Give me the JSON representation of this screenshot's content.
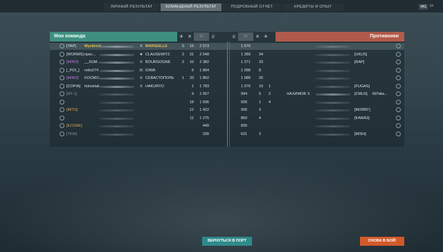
{
  "tabs": [
    {
      "label": "ЛИЧНЫЙ РЕЗУЛЬТАТ",
      "active": false
    },
    {
      "label": "КОМАНДНЫЙ РЕЗУЛЬТАТ",
      "active": true
    },
    {
      "label": "ПОДРОБНЫЙ ОТЧЁТ",
      "active": false
    },
    {
      "label": "КРЕДИТЫ И ОПЫТ",
      "active": false
    }
  ],
  "version": {
    "badge": "WG",
    "text": "34"
  },
  "my_team": {
    "title": "Моя команда",
    "rows": [
      {
        "clan": "[YAP]",
        "name": "Mystirich",
        "tier": "X",
        "ship": "MARSEILLE",
        "kills": "5",
        "plane": "15",
        "xp": "2 573",
        "me": true
      },
      {
        "clan": "[WORMS]",
        "name": "npec...",
        "tier": "★",
        "ship": "CLAUSEWITZ",
        "kills": "2",
        "plane": "31",
        "xp": "2 548",
        "me": false
      },
      {
        "clan": "[MINO]",
        "name": "__XUM...",
        "tier": "X",
        "ship": "BOURGOGNE",
        "kills": "2",
        "plane": "10",
        "xp": "2 382",
        "me": false
      },
      {
        "clan": "[_POI_]",
        "name": "retto274",
        "tier": "IX",
        "ship": "IOWA",
        "kills": "",
        "plane": "6",
        "xp": "1 894",
        "me": false
      },
      {
        "clan": "[MINO]",
        "name": "KOCMO...",
        "tier": "X",
        "ship": "СЕВАСТОПОЛЬ",
        "kills": "1",
        "plane": "33",
        "xp": "1 862",
        "me": false
      },
      {
        "clan": "[COPIA]",
        "name": "holostiak",
        "tier": "X",
        "ship": "HAKURYŪ",
        "kills": "",
        "plane": "1",
        "xp": "1 783",
        "me": false
      },
      {
        "clan": "[RF-1]",
        "name": "",
        "tier": "",
        "ship": "",
        "kills": "",
        "plane": "9",
        "xp": "1 557",
        "me": false
      },
      {
        "clan": "",
        "name": "",
        "tier": "",
        "ship": "",
        "kills": "",
        "plane": "18",
        "xp": "1 506",
        "me": false
      },
      {
        "clan": "[MITS]",
        "name": "",
        "tier": "",
        "ship": "",
        "kills": "",
        "plane": "12",
        "xp": "1 422",
        "me": false
      },
      {
        "clan": "",
        "name": "",
        "tier": "",
        "ship": "",
        "kills": "",
        "plane": "11",
        "xp": "1 275",
        "me": false
      },
      {
        "clan": "[ECORE]",
        "name": "",
        "tier": "",
        "ship": "",
        "kills": "",
        "plane": "",
        "xp": "449",
        "me": false
      },
      {
        "clan": "[TKW]",
        "name": "",
        "tier": "",
        "ship": "",
        "kills": "",
        "plane": "",
        "xp": "339",
        "me": false
      }
    ]
  },
  "enemy_team": {
    "title": "Противники",
    "rows": [
      {
        "xp": "1 676",
        "plane": "",
        "kills": "",
        "ship": "",
        "tier": "",
        "clan": "",
        "name": ""
      },
      {
        "xp": "1 289",
        "plane": "34",
        "kills": "",
        "ship": "",
        "tier": "",
        "clan": "[UKUS]",
        "name": ""
      },
      {
        "xp": "1 271",
        "plane": "33",
        "kills": "",
        "ship": "",
        "tier": "",
        "clan": "[RAP]",
        "name": ""
      },
      {
        "xp": "1 098",
        "plane": "8",
        "kills": "",
        "ship": "",
        "tier": "",
        "clan": "",
        "name": ""
      },
      {
        "xp": "1 088",
        "plane": "26",
        "kills": "",
        "ship": "",
        "tier": "",
        "clan": "",
        "name": ""
      },
      {
        "xp": "1 076",
        "plane": "10",
        "kills": "1",
        "ship": "",
        "tier": "",
        "clan": "[FUGAS]",
        "name": ""
      },
      {
        "xp": "994",
        "plane": "5",
        "kills": "2",
        "ship": "НАХИМОВ",
        "tier": "X",
        "clan": "[CMLN]",
        "name": "69Taks..."
      },
      {
        "xp": "936",
        "plane": "1",
        "kills": "4",
        "ship": "",
        "tier": "",
        "clan": "",
        "name": ""
      },
      {
        "xp": "936",
        "plane": "3",
        "kills": "",
        "ship": "",
        "tier": "",
        "clan": "[MORBT]",
        "name": ""
      },
      {
        "xp": "850",
        "plane": "4",
        "kills": "",
        "ship": "",
        "tier": "",
        "clan": "[KAMA3]",
        "name": ""
      },
      {
        "xp": "835",
        "plane": "",
        "kills": "",
        "ship": "",
        "tier": "",
        "clan": "",
        "name": ""
      },
      {
        "xp": "631",
        "plane": "2",
        "kills": "",
        "ship": "",
        "tier": "",
        "clan": "[MISH]",
        "name": ""
      }
    ]
  },
  "buttons": {
    "port": "ВЕРНУТЬСЯ В ПОРТ",
    "battle": "СНОВА В БОЙ!"
  },
  "colors": {
    "my_team": "#3f8f80",
    "enemy": "#b25a4b",
    "port_btn": "#2f8a8a",
    "battle_btn": "#d25a2a"
  }
}
